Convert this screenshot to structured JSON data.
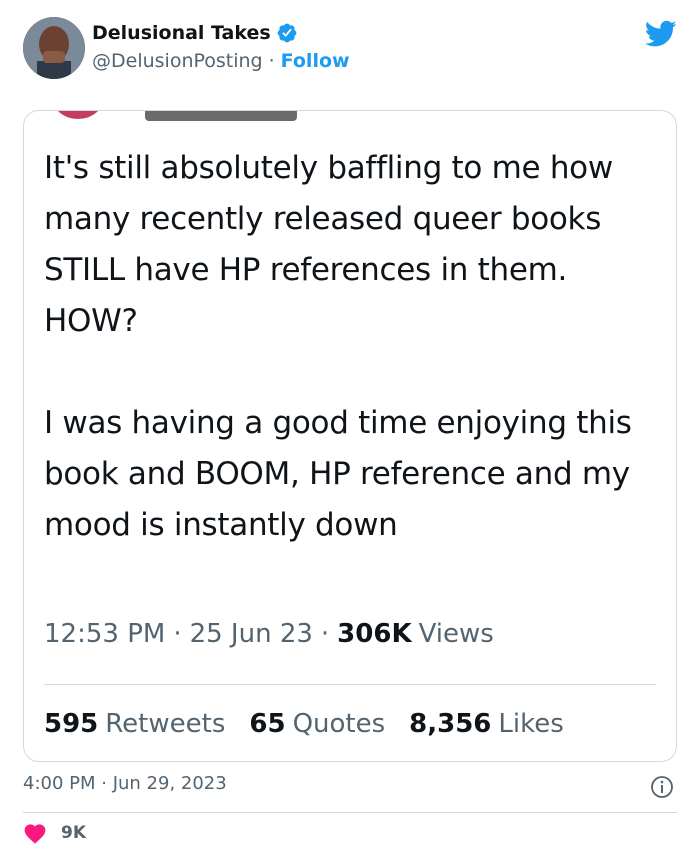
{
  "author": {
    "display_name": "Delusional Takes",
    "handle": "@DelusionPosting",
    "separator": "·",
    "follow_label": "Follow"
  },
  "quoted_tweet": {
    "text": "It's still absolutely baffling to me how many recently released queer books STILL have HP references in them. HOW?\n\nI was having a good time enjoying this book and BOOM, HP reference and my mood is instantly down",
    "time": "12:53 PM",
    "date": "25 Jun 23",
    "views_count": "306K",
    "views_label": "Views",
    "retweets_count": "595",
    "retweets_label": "Retweets",
    "quotes_count": "65",
    "quotes_label": "Quotes",
    "likes_count": "8,356",
    "likes_label": "Likes"
  },
  "footer": {
    "timestamp": "4:00 PM · Jun 29, 2023",
    "like_count": "9K"
  },
  "colors": {
    "accent": "#1d9bf0",
    "heart": "#f91880",
    "secondary_text": "#536471",
    "primary_text": "#0f1419",
    "border": "#cfd9de"
  },
  "icons": [
    "verified-badge-icon",
    "twitter-bird-icon",
    "info-icon",
    "heart-icon"
  ]
}
